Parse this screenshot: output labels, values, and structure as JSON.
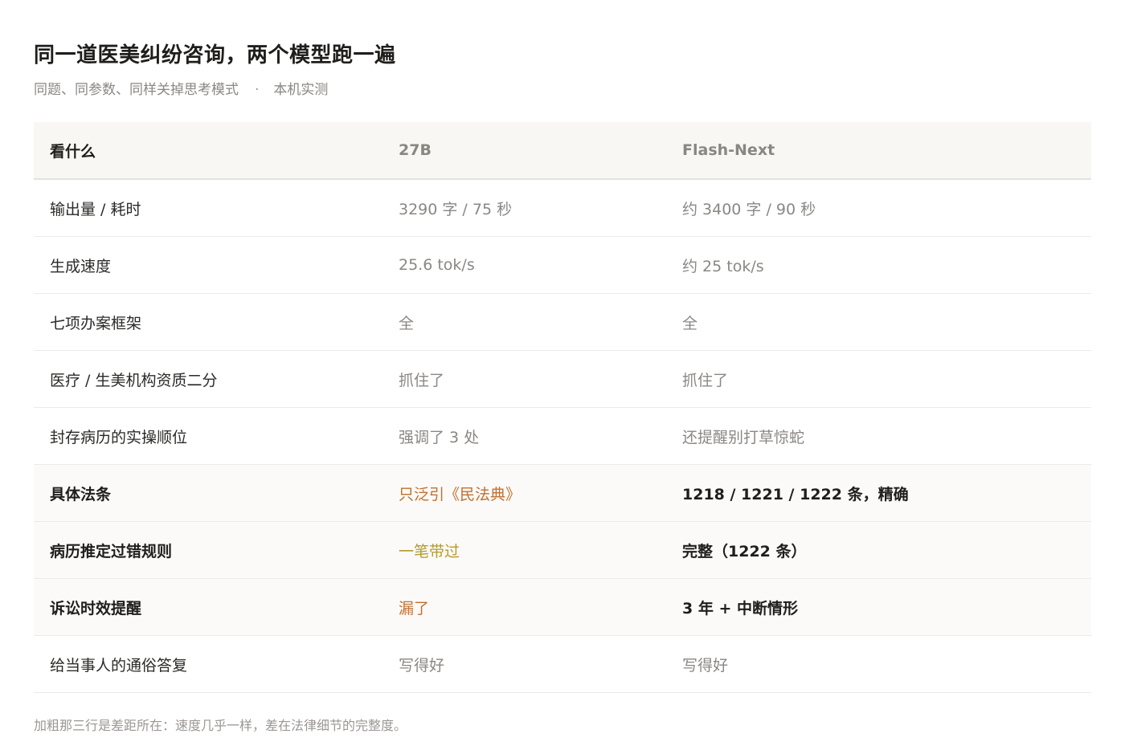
{
  "header": {
    "title": "同一道医美纠纷咨询，两个模型跑一遍",
    "subtitle_left": "同题、同参数、同样关掉思考模式",
    "subtitle_sep": "·",
    "subtitle_right": "本机实测"
  },
  "table": {
    "columns": [
      "看什么",
      "27B",
      "Flash-Next"
    ],
    "rows": [
      {
        "label": "输出量 / 耗时",
        "a": "3290 字 / 75 秒",
        "b": "约 3400 字 / 90 秒"
      },
      {
        "label": "生成速度",
        "a": "25.6 tok/s",
        "b": "约 25 tok/s"
      },
      {
        "label": "七项办案框架",
        "a": "全",
        "b": "全"
      },
      {
        "label": "医疗 / 生美机构资质二分",
        "a": "抓住了",
        "b": "抓住了"
      },
      {
        "label": "封存病历的实操顺位",
        "a": "强调了 3 处",
        "b": "还提醒别打草惊蛇"
      },
      {
        "label": "具体法条",
        "a": "只泛引《民法典》",
        "b": "1218 / 1221 / 1222 条，精确"
      },
      {
        "label": "病历推定过错规则",
        "a": "一笔带过",
        "b": "完整（1222 条）"
      },
      {
        "label": "诉讼时效提醒",
        "a": "漏了",
        "b": "3 年 + 中断情形"
      },
      {
        "label": "给当事人的通俗答复",
        "a": "写得好",
        "b": "写得好"
      }
    ]
  },
  "colors": {
    "highlight_orange": "#c1702f",
    "highlight_gold": "#b59a2a"
  },
  "footnote": "加粗那三行是差距所在：速度几乎一样，差在法律细节的完整度。"
}
